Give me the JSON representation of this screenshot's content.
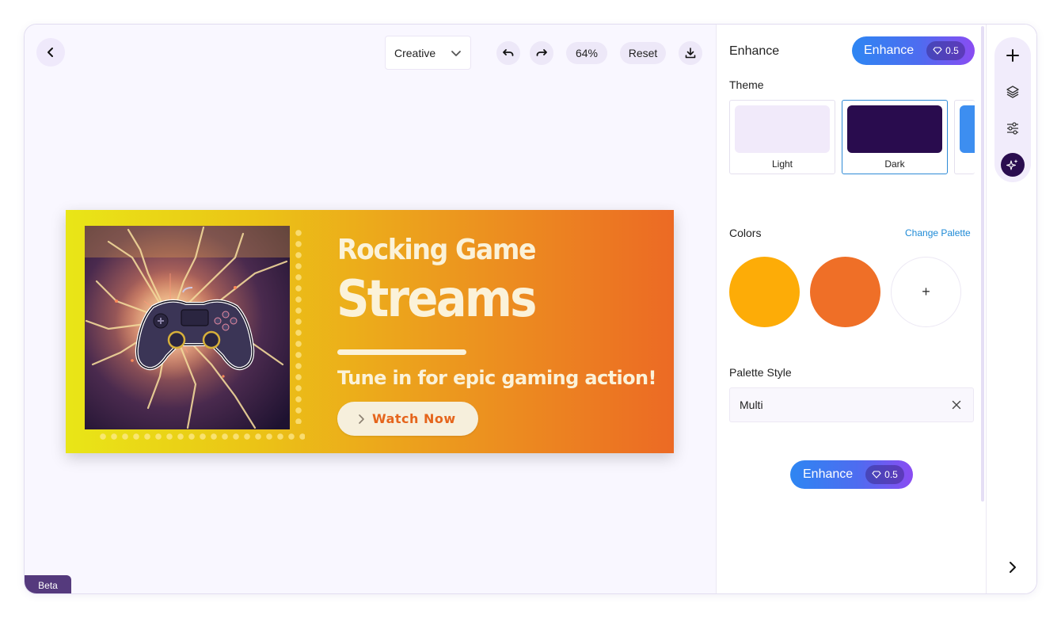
{
  "toolbar": {
    "mode": "Creative",
    "zoom": "64%",
    "reset_label": "Reset",
    "icons": [
      "back-icon",
      "chevron-down-icon",
      "undo-icon",
      "redo-icon",
      "download-icon"
    ]
  },
  "banner": {
    "title_line1": "Rocking Game",
    "title_line2": "Streams",
    "subtitle": "Tune in for epic gaming action!",
    "cta_label": "Watch Now",
    "gradient": [
      "#e9e617",
      "#ec6a24"
    ],
    "text_color": "#fbf2d9",
    "cta_text_color": "#e5651c"
  },
  "beta_label": "Beta",
  "panel": {
    "title": "Enhance",
    "enhance_label": "Enhance",
    "enhance_cost": "0.5",
    "theme_label": "Theme",
    "themes": [
      {
        "name": "Light",
        "color": "#f1eafa",
        "selected": false
      },
      {
        "name": "Dark",
        "color": "#290c4e",
        "selected": true
      },
      {
        "name": "",
        "color": "#3d8ef0",
        "selected": false
      }
    ],
    "colors_label": "Colors",
    "change_palette_label": "Change Palette",
    "colors": [
      "#fdac07",
      "#ef6f27"
    ],
    "add_color_label": "+",
    "palette_style_label": "Palette Style",
    "palette_style_value": "Multi",
    "bottom_enhance_label": "Enhance",
    "bottom_enhance_cost": "0.5"
  },
  "rail": {
    "icons": [
      "plus-icon",
      "layers-icon",
      "sliders-icon",
      "sparkle-icon",
      "chevron-right-icon"
    ],
    "active": "sparkle-icon"
  },
  "colors": {
    "accent_blue": "#2e86f2",
    "accent_purple": "#8a4cf2",
    "link": "#1e8ad6",
    "beta_bg": "#553a7d"
  }
}
